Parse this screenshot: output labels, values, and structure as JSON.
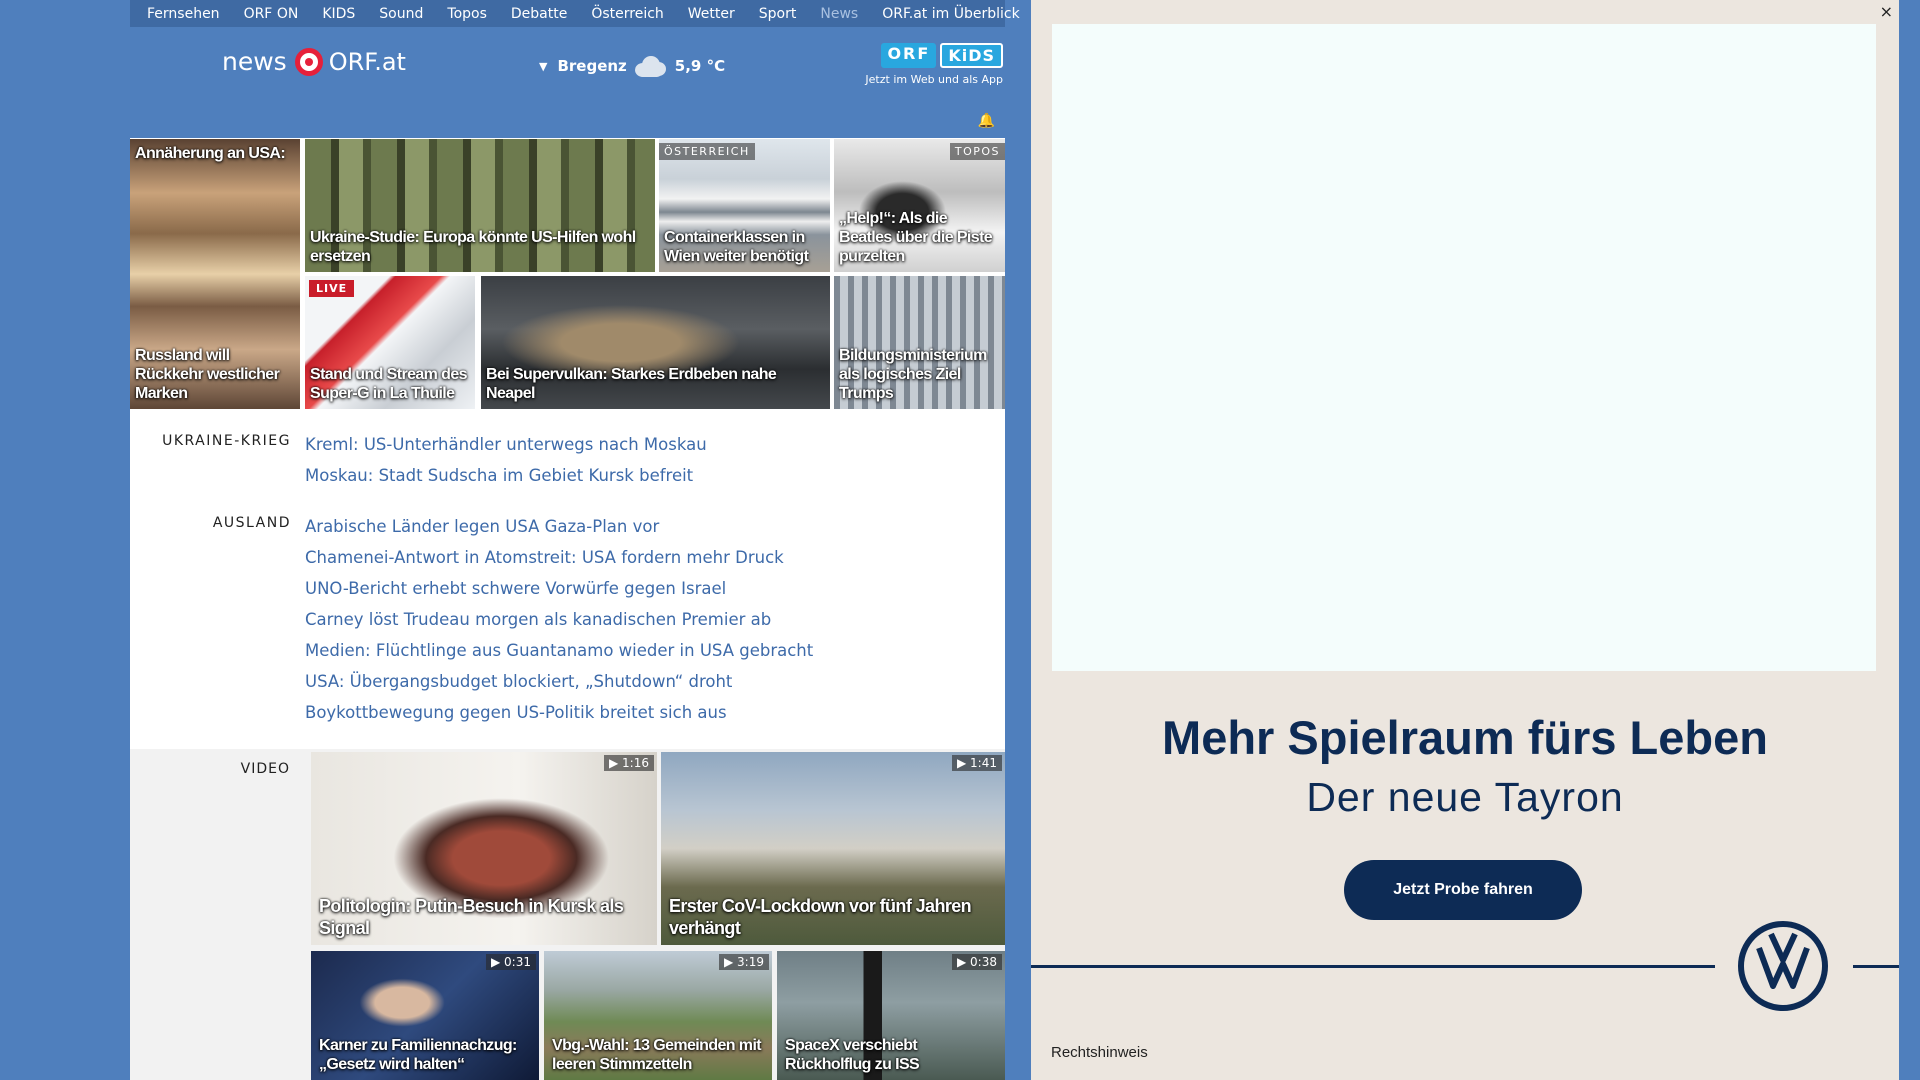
{
  "topnav": {
    "items": [
      "Fernsehen",
      "ORF ON",
      "KIDS",
      "Sound",
      "Topos",
      "Debatte",
      "Österreich",
      "Wetter",
      "Sport",
      "News"
    ],
    "overview": "ORF.at im Überblick"
  },
  "header": {
    "logo_news": "news",
    "logo_orfat": "ORF.at",
    "weather": {
      "city": "Bregenz",
      "temp": "5,9 °C",
      "icon": "cloud-icon"
    },
    "kids_promo": {
      "orf": "ORF",
      "kids": "KiDS",
      "text": "Jetzt im Web und als App"
    }
  },
  "tiles": [
    {
      "caption_top": "Annäherung an USA:",
      "caption": "Russland will Rückkehr westlicher Marken"
    },
    {
      "caption": "Ukraine-Studie: Europa könnte US-Hilfen wohl ersetzen"
    },
    {
      "kicker": "ÖSTERREICH",
      "caption": "Containerklassen in Wien weiter benötigt"
    },
    {
      "kicker": "TOPOS",
      "caption": "„Help!“: Als die Beatles über die Piste purzelten"
    },
    {
      "live": "LIVE",
      "caption": "Stand und Stream des Super-G in La Thuile"
    },
    {
      "caption": "Bei Supervulkan: Starkes Erdbeben nahe Neapel"
    },
    {
      "caption": "Bildungsministerium als logisches Ziel Trumps"
    }
  ],
  "sections": [
    {
      "label": "UKRAINE-KRIEG",
      "links": [
        "Kreml: US-Unterhändler unterwegs nach Moskau",
        "Moskau: Stadt Sudscha im Gebiet Kursk befreit"
      ]
    },
    {
      "label": "AUSLAND",
      "links": [
        "Arabische Länder legen USA Gaza-Plan vor",
        "Chamenei-Antwort in Atomstreit: USA fordern mehr Druck",
        "UNO-Bericht erhebt schwere Vorwürfe gegen Israel",
        "Carney löst Trudeau morgen als kanadischen Premier ab",
        "Medien: Flüchtlinge aus Guantanamo wieder in USA gebracht",
        "USA: Übergangsbudget blockiert, „Shutdown“ droht",
        "Boykottbewegung gegen US-Politik breitet sich aus"
      ]
    }
  ],
  "video": {
    "label": "VIDEO",
    "items": [
      {
        "duration": "1:16",
        "caption": "Politologin: Putin-Besuch in Kursk als Signal"
      },
      {
        "duration": "1:41",
        "caption": "Erster CoV-Lockdown vor fünf Jahren verhängt"
      },
      {
        "duration": "0:31",
        "caption": "Karner zu Familiennachzug: „Gesetz wird halten“"
      },
      {
        "duration": "3:19",
        "caption": "Vbg.-Wahl: 13 Gemeinden mit leeren Stimmzetteln"
      },
      {
        "duration": "0:38",
        "caption": "SpaceX verschiebt Rückholflug zu ISS"
      }
    ]
  },
  "ad": {
    "close": "×",
    "headline": "Mehr Spielraum fürs Leben",
    "subline": "Der neue Tayron",
    "cta": "Jetzt Probe fahren",
    "legal": "Rechtshinweis",
    "brand_color": "#0d2b55"
  },
  "colors": {
    "accent": "#4f7fbd",
    "link": "#3d6aa9",
    "live": "#c91d2a"
  }
}
